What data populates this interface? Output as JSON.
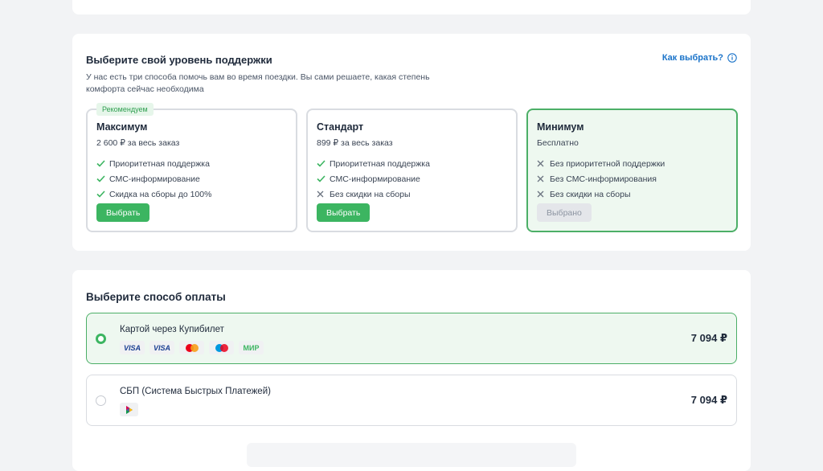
{
  "support": {
    "title": "Выберите свой уровень поддержки",
    "how_link": "Как выбрать?",
    "description": "У нас есть три способа помочь вам во время поездки. Вы сами решаете, какая степень комфорта сейчас необходима",
    "tiers": [
      {
        "badge": "Рекомендуем",
        "name": "Максимум",
        "price": "2 600 ₽ за весь заказ",
        "features": [
          {
            "text": "Приоритетная поддержка",
            "included": true
          },
          {
            "text": "СМС-информирование",
            "included": true
          },
          {
            "text": "Скидка на сборы до 100%",
            "included": true
          }
        ],
        "button": "Выбрать"
      },
      {
        "name": "Стандарт",
        "price": "899 ₽ за весь заказ",
        "features": [
          {
            "text": "Приоритетная поддержка",
            "included": true
          },
          {
            "text": "СМС-информирование",
            "included": true
          },
          {
            "text": "Без скидки на сборы",
            "included": false
          }
        ],
        "button": "Выбрать"
      },
      {
        "name": "Минимум",
        "price": "Бесплатно",
        "features": [
          {
            "text": "Без приоритетной поддержки",
            "included": false
          },
          {
            "text": "Без СМС-информирования",
            "included": false
          },
          {
            "text": "Без скидки на сборы",
            "included": false
          }
        ],
        "button": "Выбрано",
        "selected": true
      }
    ]
  },
  "payment": {
    "title": "Выберите способ оплаты",
    "options": [
      {
        "name": "Картой через Купибилет",
        "amount": "7 094 ₽",
        "selected": true,
        "logos": [
          "VISA",
          "VISA",
          "mastercard-icon",
          "maestro-icon",
          "МИР"
        ]
      },
      {
        "name": "СБП (Система Быстрых Платежей)",
        "amount": "7 094 ₽",
        "selected": false,
        "logos": [
          "sbp-icon"
        ]
      }
    ]
  },
  "colors": {
    "accent_green": "#3cb561",
    "link_blue": "#1a73c9",
    "selected_bg": "#eef8f0",
    "border": "#d9dce1"
  }
}
